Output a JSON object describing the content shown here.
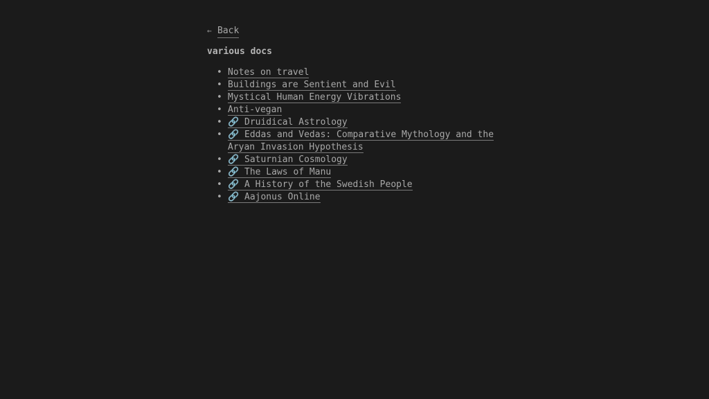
{
  "nav": {
    "back_icon": "←",
    "back_label": "Back"
  },
  "page": {
    "title": "various docs"
  },
  "link_icon": "🔗",
  "docs": [
    {
      "label": "Notes on travel",
      "external": false
    },
    {
      "label": "Buildings are Sentient and Evil",
      "external": false
    },
    {
      "label": "Mystical Human Energy Vibrations",
      "external": false
    },
    {
      "label": "Anti-vegan",
      "external": false
    },
    {
      "label": "Druidical Astrology",
      "external": true
    },
    {
      "label": "Eddas and Vedas: Comparative Mythology and the Aryan Invasion Hypothesis",
      "external": true
    },
    {
      "label": "Saturnian Cosmology",
      "external": true
    },
    {
      "label": "The Laws of Manu",
      "external": true
    },
    {
      "label": "A History of the Swedish People",
      "external": true
    },
    {
      "label": "Aajonus Online",
      "external": true
    }
  ]
}
